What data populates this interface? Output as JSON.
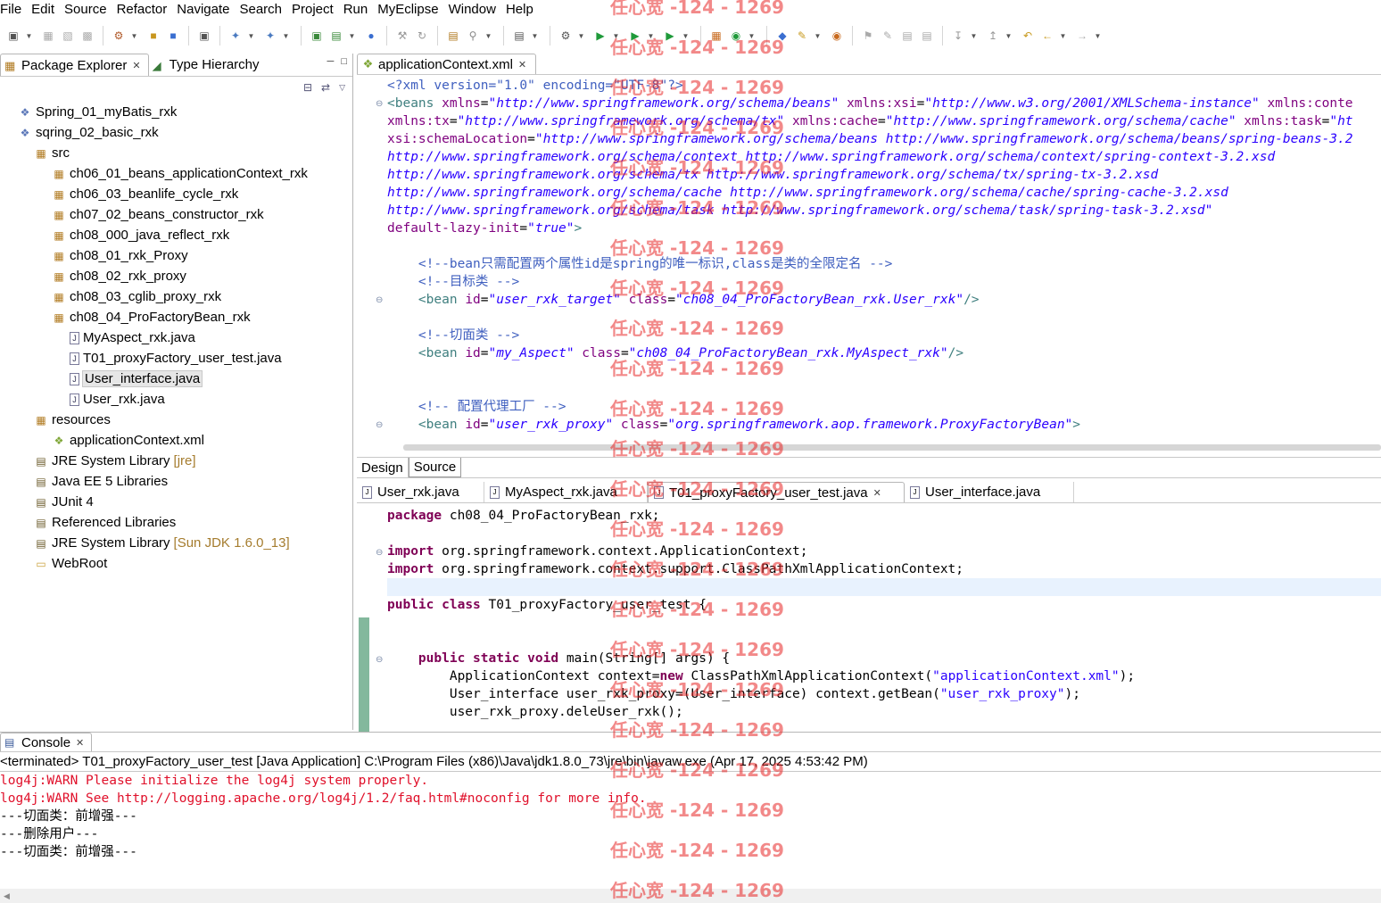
{
  "menu": [
    "File",
    "Edit",
    "Source",
    "Refactor",
    "Navigate",
    "Search",
    "Project",
    "Run",
    "MyEclipse",
    "Window",
    "Help"
  ],
  "left_panel": {
    "tabs": [
      {
        "label": "Package Explorer",
        "active": true
      },
      {
        "label": "Type Hierarchy",
        "active": false
      }
    ],
    "tree": [
      {
        "label": "Spring_01_myBatis_rxk",
        "indent": 0,
        "icon": "project-icon"
      },
      {
        "label": "sqring_02_basic_rxk",
        "indent": 0,
        "icon": "project-icon"
      },
      {
        "label": "src",
        "indent": 1,
        "icon": "source-folder-icon"
      },
      {
        "label": "ch06_01_beans_applicationContext_rxk",
        "indent": 2,
        "icon": "package-icon"
      },
      {
        "label": "ch06_03_beanlife_cycle_rxk",
        "indent": 2,
        "icon": "package-icon"
      },
      {
        "label": "ch07_02_beans_constructor_rxk",
        "indent": 2,
        "icon": "package-icon"
      },
      {
        "label": "ch08_000_java_reflect_rxk",
        "indent": 2,
        "icon": "package-icon"
      },
      {
        "label": "ch08_01_rxk_Proxy",
        "indent": 2,
        "icon": "package-icon"
      },
      {
        "label": "ch08_02_rxk_proxy",
        "indent": 2,
        "icon": "package-icon"
      },
      {
        "label": "ch08_03_cglib_proxy_rxk",
        "indent": 2,
        "icon": "package-icon"
      },
      {
        "label": "ch08_04_ProFactoryBean_rxk",
        "indent": 2,
        "icon": "package-icon"
      },
      {
        "label": "MyAspect_rxk.java",
        "indent": 3,
        "icon": "java-file-icon"
      },
      {
        "label": "T01_proxyFactory_user_test.java",
        "indent": 3,
        "icon": "java-file-icon"
      },
      {
        "label": "User_interface.java",
        "indent": 3,
        "icon": "java-file-icon",
        "selected": true
      },
      {
        "label": "User_rxk.java",
        "indent": 3,
        "icon": "java-file-icon"
      },
      {
        "label": "resources",
        "indent": 1,
        "icon": "source-folder-icon"
      },
      {
        "label": "applicationContext.xml",
        "indent": 2,
        "icon": "xml-file-icon"
      },
      {
        "label": "JRE System Library",
        "suffix": "[jre]",
        "indent": 1,
        "icon": "library-icon"
      },
      {
        "label": "Java EE 5 Libraries",
        "indent": 1,
        "icon": "library-icon"
      },
      {
        "label": "JUnit 4",
        "indent": 1,
        "icon": "library-icon"
      },
      {
        "label": "Referenced Libraries",
        "indent": 1,
        "icon": "library-icon"
      },
      {
        "label": "JRE System Library",
        "suffix": "[Sun JDK 1.6.0_13]",
        "indent": 1,
        "icon": "library-icon"
      },
      {
        "label": "WebRoot",
        "indent": 1,
        "icon": "folder-icon"
      }
    ]
  },
  "xml_editor": {
    "tab": "applicationContext.xml",
    "lines": [
      [
        {
          "t": "<?xml version=\"1.0\" encoding=\"UTF-8\"?>",
          "c": "c-pi"
        }
      ],
      [
        {
          "t": "<beans ",
          "c": "c-tag"
        },
        {
          "t": "xmlns",
          "c": "c-attr"
        },
        {
          "t": "=",
          "c": "c-punct"
        },
        {
          "t": "\"http://www.springframework.org/schema/beans\"",
          "c": "c-val"
        },
        {
          "t": " xmlns:xsi",
          "c": "c-attr"
        },
        {
          "t": "=",
          "c": "c-punct"
        },
        {
          "t": "\"http://www.w3.org/2001/XMLSchema-instance\"",
          "c": "c-val"
        },
        {
          "t": " xmlns:conte",
          "c": "c-attr"
        }
      ],
      [
        {
          "t": "xmlns:tx",
          "c": "c-attr"
        },
        {
          "t": "=",
          "c": "c-punct"
        },
        {
          "t": "\"http://www.springframework.org/schema/tx\"",
          "c": "c-val"
        },
        {
          "t": " xmlns:cache",
          "c": "c-attr"
        },
        {
          "t": "=",
          "c": "c-punct"
        },
        {
          "t": "\"http://www.springframework.org/schema/cache\"",
          "c": "c-val"
        },
        {
          "t": " xmlns:task",
          "c": "c-attr"
        },
        {
          "t": "=",
          "c": "c-punct"
        },
        {
          "t": "\"ht",
          "c": "c-val"
        }
      ],
      [
        {
          "t": "xsi:schemaLocation",
          "c": "c-attr"
        },
        {
          "t": "=",
          "c": "c-punct"
        },
        {
          "t": "\"http://www.springframework.org/schema/beans http://www.springframework.org/schema/beans/spring-beans-3.2",
          "c": "c-val"
        }
      ],
      [
        {
          "t": "http://www.springframework.org/schema/context http://www.springframework.org/schema/context/spring-context-3.2.xsd",
          "c": "c-val"
        }
      ],
      [
        {
          "t": "http://www.springframework.org/schema/tx http://www.springframework.org/schema/tx/spring-tx-3.2.xsd",
          "c": "c-val"
        }
      ],
      [
        {
          "t": "http://www.springframework.org/schema/cache http://www.springframework.org/schema/cache/spring-cache-3.2.xsd",
          "c": "c-val"
        }
      ],
      [
        {
          "t": "http://www.springframework.org/schema/task http://www.springframework.org/schema/task/spring-task-3.2.xsd\"",
          "c": "c-val"
        }
      ],
      [
        {
          "t": "default-lazy-init",
          "c": "c-attr"
        },
        {
          "t": "=",
          "c": "c-punct"
        },
        {
          "t": "\"true\"",
          "c": "c-val"
        },
        {
          "t": ">",
          "c": "c-tag"
        }
      ],
      [],
      [
        {
          "t": "    <!--bean只需配置两个属性id是spring的唯一标识,class是类的全限定名 -->",
          "c": "c-com"
        }
      ],
      [
        {
          "t": "    <!--目标类 -->",
          "c": "c-com"
        }
      ],
      [
        {
          "t": "    <bean ",
          "c": "c-tag"
        },
        {
          "t": "id",
          "c": "c-attr"
        },
        {
          "t": "=",
          "c": "c-punct"
        },
        {
          "t": "\"user_rxk_target\"",
          "c": "c-val"
        },
        {
          "t": " class",
          "c": "c-attr"
        },
        {
          "t": "=",
          "c": "c-punct"
        },
        {
          "t": "\"ch08_04_ProFactoryBean_rxk.User_rxk\"",
          "c": "c-val"
        },
        {
          "t": "/>",
          "c": "c-tag"
        }
      ],
      [],
      [
        {
          "t": "    <!--切面类 -->",
          "c": "c-com"
        }
      ],
      [
        {
          "t": "    <bean ",
          "c": "c-tag"
        },
        {
          "t": "id",
          "c": "c-attr"
        },
        {
          "t": "=",
          "c": "c-punct"
        },
        {
          "t": "\"my_Aspect\"",
          "c": "c-val"
        },
        {
          "t": " class",
          "c": "c-attr"
        },
        {
          "t": "=",
          "c": "c-punct"
        },
        {
          "t": "\"ch08_04_ProFactoryBean_rxk.MyAspect_rxk\"",
          "c": "c-val"
        },
        {
          "t": "/>",
          "c": "c-tag"
        }
      ],
      [],
      [],
      [
        {
          "t": "    <!-- 配置代理工厂 -->",
          "c": "c-com"
        }
      ],
      [
        {
          "t": "    <bean ",
          "c": "c-tag"
        },
        {
          "t": "id",
          "c": "c-attr"
        },
        {
          "t": "=",
          "c": "c-punct"
        },
        {
          "t": "\"user_rxk_proxy\"",
          "c": "c-val"
        },
        {
          "t": " class",
          "c": "c-attr"
        },
        {
          "t": "=",
          "c": "c-punct"
        },
        {
          "t": "\"org.springframework.aop.framework.ProxyFactoryBean\"",
          "c": "c-val"
        },
        {
          "t": ">",
          "c": "c-tag"
        }
      ]
    ],
    "bottom_tabs": [
      {
        "label": "Design",
        "active": false
      },
      {
        "label": "Source",
        "active": true
      }
    ]
  },
  "java_editor": {
    "tabs": [
      {
        "label": "User_rxk.java",
        "active": false
      },
      {
        "label": "MyAspect_rxk.java",
        "active": false
      },
      {
        "label": "T01_proxyFactory_user_test.java",
        "active": true
      },
      {
        "label": "User_interface.java",
        "active": false
      }
    ],
    "lines": [
      [
        {
          "t": "package",
          "c": "j-kw"
        },
        {
          "t": " ch08_04_ProFactoryBean_rxk;",
          "c": ""
        }
      ],
      [],
      [
        {
          "t": "import",
          "c": "j-kw"
        },
        {
          "t": " org.springframework.context.ApplicationContext;",
          "c": ""
        }
      ],
      [
        {
          "t": "import",
          "c": "j-kw"
        },
        {
          "t": " org.springframework.context.support.ClassPathXmlApplicationContext;",
          "c": ""
        }
      ],
      [],
      [
        {
          "t": "public",
          "c": "j-kw"
        },
        {
          "t": " ",
          "c": ""
        },
        {
          "t": "class",
          "c": "j-kw"
        },
        {
          "t": " T01_proxyFactory_user_test {",
          "c": ""
        }
      ],
      [],
      [],
      [
        {
          "t": "    ",
          "c": ""
        },
        {
          "t": "public",
          "c": "j-kw"
        },
        {
          "t": " ",
          "c": ""
        },
        {
          "t": "static",
          "c": "j-kw"
        },
        {
          "t": " ",
          "c": ""
        },
        {
          "t": "void",
          "c": "j-kw"
        },
        {
          "t": " main(String[] args) {",
          "c": ""
        }
      ],
      [
        {
          "t": "        ApplicationContext context=",
          "c": ""
        },
        {
          "t": "new",
          "c": "j-kw"
        },
        {
          "t": " ClassPathXmlApplicationContext(",
          "c": ""
        },
        {
          "t": "\"applicationContext.xml\"",
          "c": "j-str"
        },
        {
          "t": ");",
          "c": ""
        }
      ],
      [
        {
          "t": "        User_interface user_rxk_proxy=(User_interface) context.getBean(",
          "c": ""
        },
        {
          "t": "\"user_rxk_proxy\"",
          "c": "j-str"
        },
        {
          "t": ");",
          "c": ""
        }
      ],
      [
        {
          "t": "        user_rxk_proxy.deleUser_rxk();",
          "c": ""
        }
      ]
    ]
  },
  "console": {
    "tab": "Console",
    "header": "<terminated> T01_proxyFactory_user_test [Java Application] C:\\Program Files (x86)\\Java\\jdk1.8.0_73\\jre\\bin\\javaw.exe (Apr 17, 2025 4:53:42 PM)",
    "lines": [
      {
        "text": "log4j:WARN Please initialize the log4j system properly.",
        "error": true
      },
      {
        "text": "log4j:WARN See http://logging.apache.org/log4j/1.2/faq.html#noconfig for more info.",
        "error": true
      },
      {
        "text": "---切面类：前增强---",
        "error": false
      },
      {
        "text": "---删除用户---",
        "error": false
      },
      {
        "text": "---切面类：前增强---",
        "error": false
      }
    ]
  },
  "watermark": "任心宽 -124 - 1269",
  "colors": {
    "keyword": "#7f0055",
    "string": "#2a00ff",
    "xml_attr": "#7f007f",
    "xml_tag": "#3f7f7f",
    "comment": "#3f5fbf",
    "console_error": "#e0102a",
    "watermark": "#e82828"
  }
}
